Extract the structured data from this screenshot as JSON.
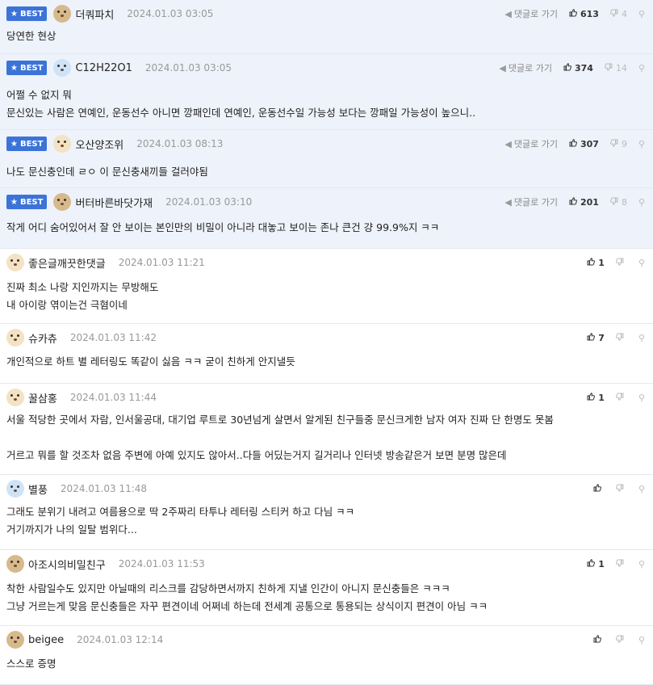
{
  "labels": {
    "best": "BEST",
    "reply_link": "댓글로 가기"
  },
  "comments": [
    {
      "best": true,
      "nick": "더쿼파치",
      "date": "2024.01.03 03:05",
      "up": "613",
      "down": "4",
      "lines": [
        "당연한 현상"
      ]
    },
    {
      "best": true,
      "nick": "C12H22O1",
      "date": "2024.01.03 03:05",
      "up": "374",
      "down": "14",
      "lines": [
        "어쩔 수 없지 뭐",
        "문신있는 사람은 연예인, 운동선수 아니면 깡패인데 연예인, 운동선수일 가능성 보다는 깡패일 가능성이 높으니.."
      ]
    },
    {
      "best": true,
      "nick": "오산양조위",
      "date": "2024.01.03 08:13",
      "up": "307",
      "down": "9",
      "lines": [
        "나도 문신충인데 ㄹㅇ 이 문신충새끼들 걸러야됨"
      ]
    },
    {
      "best": true,
      "nick": "버터바른바닷가재",
      "date": "2024.01.03 03:10",
      "up": "201",
      "down": "8",
      "lines": [
        "작게 어디 숨어있어서 잘 안 보이는 본인만의 비밀이 아니라 대놓고 보이는 존나 큰건 걍 99.9%지 ㅋㅋ"
      ]
    },
    {
      "best": false,
      "nick": "좋은글깨끗한댓글",
      "date": "2024.01.03 11:21",
      "up": "1",
      "down": "",
      "lines": [
        "진짜 최소 나랑 지인까지는 무방해도",
        "내 아이랑 엮이는건 극혐이네"
      ]
    },
    {
      "best": false,
      "nick": "슈카츄",
      "date": "2024.01.03 11:42",
      "up": "7",
      "down": "",
      "lines": [
        "개인적으로 하트 별 레터링도 똑같이 싫음 ㅋㅋ 굳이 친하게 안지낼듯"
      ]
    },
    {
      "best": false,
      "nick": "꿀삼홍",
      "date": "2024.01.03 11:44",
      "up": "1",
      "down": "",
      "lines": [
        "서울 적당한 곳에서 자람, 인서울공대, 대기업 루트로 30년넘게 살면서 알게된 친구들중 문신크게한 남자 여자 진짜 단 한명도 못봄",
        "",
        "거르고 뭐를 할 것조차 없음 주변에 아예 있지도 않아서..다들 어딨는거지 길거리나 인터넷 방송같은거 보면 분명 많은데"
      ]
    },
    {
      "best": false,
      "nick": "별풍",
      "date": "2024.01.03 11:48",
      "up": "",
      "down": "",
      "lines": [
        "그래도 분위기 내려고 여름용으로 딱 2주짜리 타투나 레터링 스티커 하고 다님 ㅋㅋ",
        "거기까지가 나의 일탈 범위다..."
      ]
    },
    {
      "best": false,
      "nick": "아조시의비밀친구",
      "date": "2024.01.03 11:53",
      "up": "1",
      "down": "",
      "lines": [
        "착한 사람일수도 있지만 아닐때의 리스크를 감당하면서까지 친하게 지낼 인간이 아니지 문신충들은 ㅋㅋㅋ",
        "그냥 거르는게 맞음 문신충들은 자꾸 편견이네 어쩌네 하는데 전세계 공통으로 통용되는 상식이지 편견이 아님 ㅋㅋ"
      ]
    },
    {
      "best": false,
      "nick": "beigee",
      "date": "2024.01.03 12:14",
      "up": "",
      "down": "",
      "lines": [
        "스스로 증명"
      ]
    }
  ]
}
